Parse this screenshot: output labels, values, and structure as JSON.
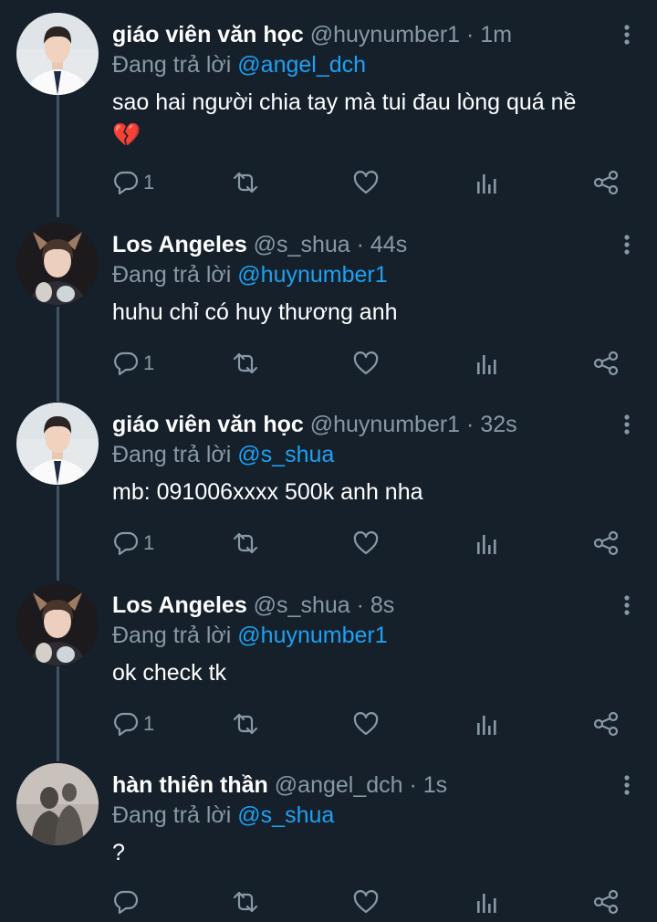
{
  "reply_prefix": "Đang trả lời",
  "tweets": [
    {
      "name": "giáo viên văn học",
      "handle": "@huynumber1",
      "sep": "·",
      "time": "1m",
      "reply_to": "@angel_dch",
      "text": "sao hai người chia tay mà tui đau lòng quá nề",
      "emoji": "💔",
      "reply_count": "1",
      "avatar": "boy-white-shirt"
    },
    {
      "name": "Los Angeles",
      "handle": "@s_shua",
      "sep": "·",
      "time": "44s",
      "reply_to": "@huynumber1",
      "text": "huhu chỉ có huy thương anh",
      "reply_count": "1",
      "avatar": "boy-deer-ears"
    },
    {
      "name": "giáo viên văn học",
      "handle": "@huynumber1",
      "sep": "·",
      "time": "32s",
      "reply_to": "@s_shua",
      "text": "mb: 091006xxxx 500k anh nha",
      "reply_count": "1",
      "avatar": "boy-white-shirt"
    },
    {
      "name": "Los Angeles",
      "handle": "@s_shua",
      "sep": "·",
      "time": "8s",
      "reply_to": "@huynumber1",
      "text": "ok check tk",
      "reply_count": "1",
      "avatar": "boy-deer-ears"
    },
    {
      "name": "hàn thiên thần",
      "handle": "@angel_dch",
      "sep": "·",
      "time": "1s",
      "reply_to": "@s_shua",
      "text": "?",
      "reply_count": "",
      "avatar": "shadow-silhouettes"
    }
  ],
  "icons": {
    "reply": "comment-icon",
    "retweet": "retweet-icon",
    "like": "heart-icon",
    "stats": "analytics-icon",
    "share": "share-icon",
    "more": "more-vertical-icon"
  },
  "colors": {
    "background": "#15202b",
    "secondary": "#8899a6",
    "accent": "#1da1f2",
    "thread": "#3d5466"
  }
}
